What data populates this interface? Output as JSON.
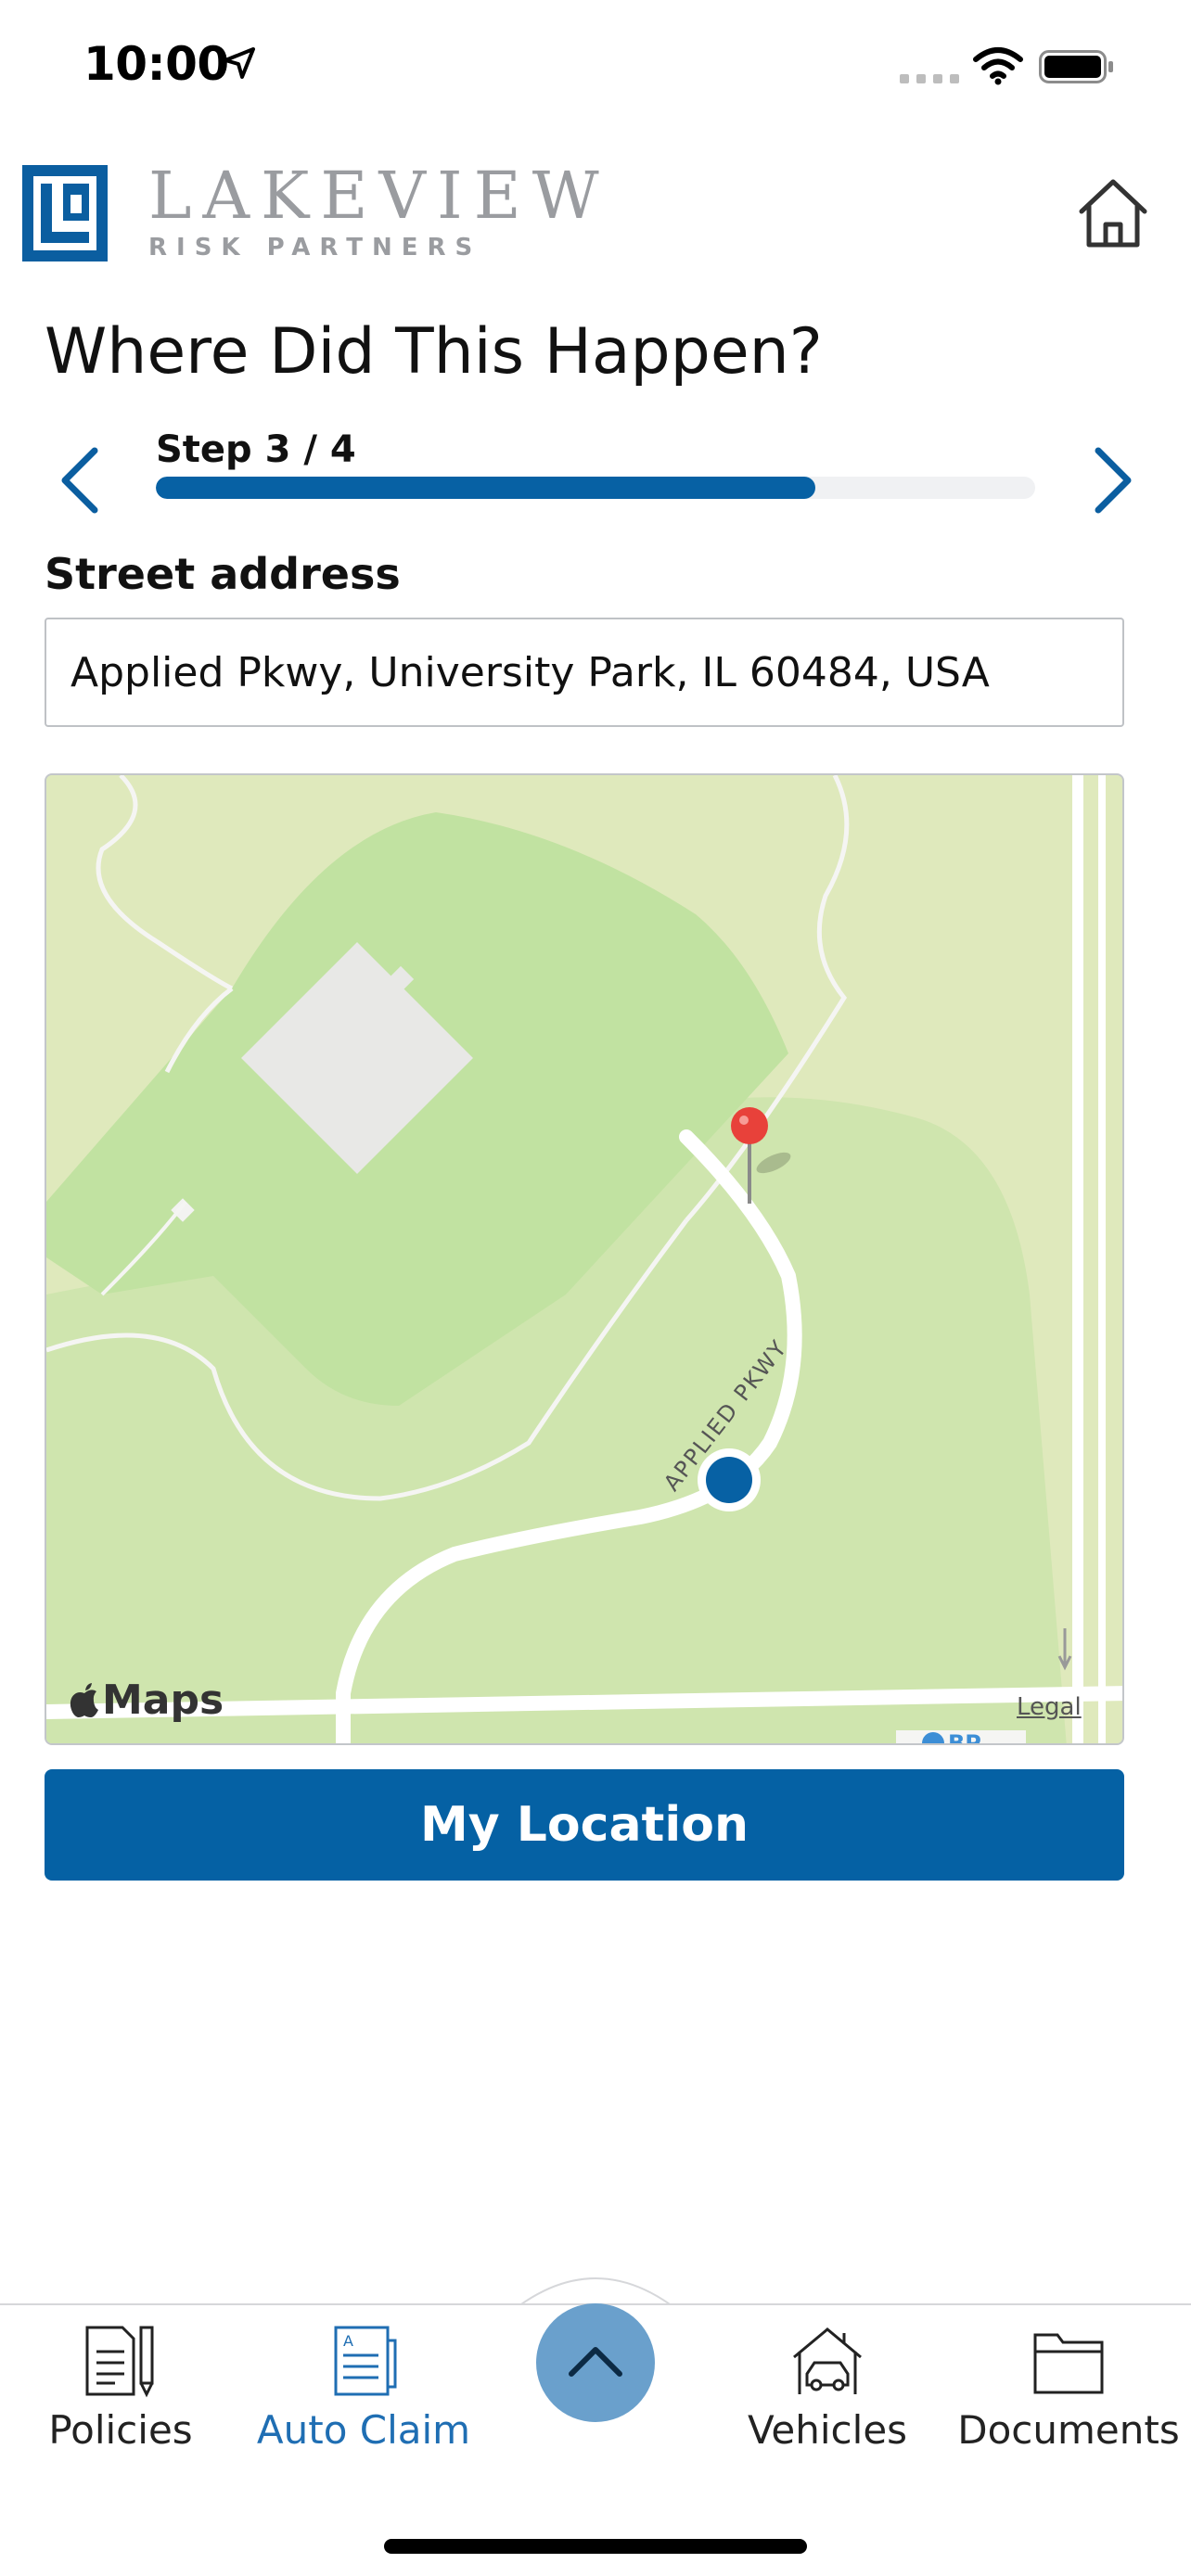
{
  "status_bar": {
    "time": "10:00"
  },
  "brand": {
    "name": "LAKEVIEW",
    "tagline": "RISK PARTNERS",
    "color": "#0b5ea0"
  },
  "header": {
    "home_icon": "home-icon"
  },
  "page": {
    "title": "Where Did This Happen?"
  },
  "stepper": {
    "label": "Step 3 / 4",
    "current": 3,
    "total": 4,
    "progress_fraction": 0.75
  },
  "address": {
    "label": "Street address",
    "value": "Applied Pkwy, University Park, IL 60484, USA"
  },
  "map": {
    "provider": "Maps",
    "legal": "Legal",
    "road_label": "APPLIED PKWY",
    "poi_label": "BP"
  },
  "actions": {
    "my_location": "My Location"
  },
  "tabs": [
    {
      "label": "Policies",
      "icon": "policies-icon",
      "active": false
    },
    {
      "label": "Auto Claim",
      "icon": "auto-claim-icon",
      "active": true
    },
    {
      "label": "Vehicles",
      "icon": "vehicles-icon",
      "active": false
    },
    {
      "label": "Documents",
      "icon": "documents-icon",
      "active": false
    }
  ],
  "colors": {
    "accent": "#0561a4",
    "active_tab": "#1f6eb3",
    "pin": "#e8413a"
  }
}
